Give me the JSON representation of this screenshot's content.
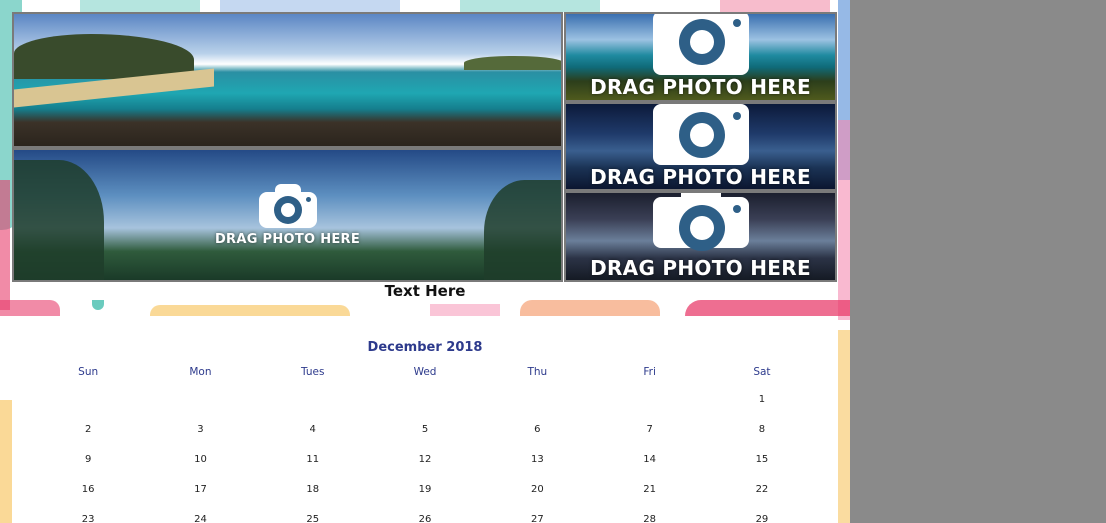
{
  "photo_placeholder": {
    "drag_label": "DRAG PHOTO HERE"
  },
  "caption": "Text Here",
  "calendar": {
    "month_title": "December 2018",
    "weekdays": [
      "Sun",
      "Mon",
      "Tues",
      "Wed",
      "Thu",
      "Fri",
      "Sat"
    ],
    "days": [
      [
        "",
        "",
        "",
        "",
        "",
        "",
        "1"
      ],
      [
        "2",
        "3",
        "4",
        "5",
        "6",
        "7",
        "8"
      ],
      [
        "9",
        "10",
        "11",
        "12",
        "13",
        "14",
        "15"
      ],
      [
        "16",
        "17",
        "18",
        "19",
        "20",
        "21",
        "22"
      ],
      [
        "23",
        "24",
        "25",
        "26",
        "27",
        "28",
        "29"
      ]
    ]
  },
  "colors": {
    "accent": "#2d3a8c",
    "workspace": "#8a8a8a",
    "confetti": [
      "#e83e6c",
      "#f5b941",
      "#2bb5a3",
      "#3f7fd1",
      "#f27b3e",
      "#f58bb0"
    ]
  }
}
